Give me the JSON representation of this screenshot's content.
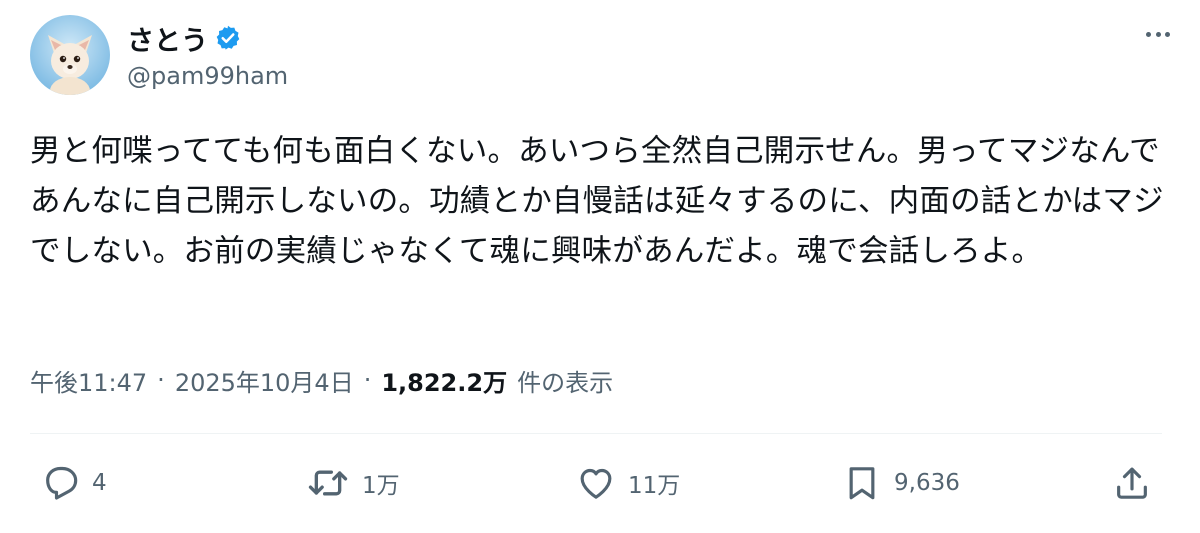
{
  "user": {
    "display_name": "さとう",
    "handle": "@pam99ham",
    "verified_color": "#1d9bf0"
  },
  "tweet": {
    "text": "男と何喋ってても何も面白くない。あいつら全然自己開示せん。男ってマジなんであんなに自己開示しないの。功績とか自慢話は延々するのに、内面の話とかはマジでしない。お前の実績じゃなくて魂に興味があんだよ。魂で会話しろよ。"
  },
  "meta": {
    "time": "午後11:47",
    "separator": "·",
    "date": "2025年10月4日",
    "views_count": "1,822.2万",
    "views_label": "件の表示"
  },
  "actions": {
    "reply": {
      "icon": "reply-icon",
      "count": "4"
    },
    "repost": {
      "icon": "repost-icon",
      "count": "1万"
    },
    "like": {
      "icon": "heart-icon",
      "count": "11万"
    },
    "bookmark": {
      "icon": "bookmark-icon",
      "count": "9,636"
    },
    "share": {
      "icon": "share-icon"
    }
  },
  "colors": {
    "text": "#0f1419",
    "secondary": "#536471",
    "divider": "#eff3f4",
    "accent": "#1d9bf0"
  }
}
